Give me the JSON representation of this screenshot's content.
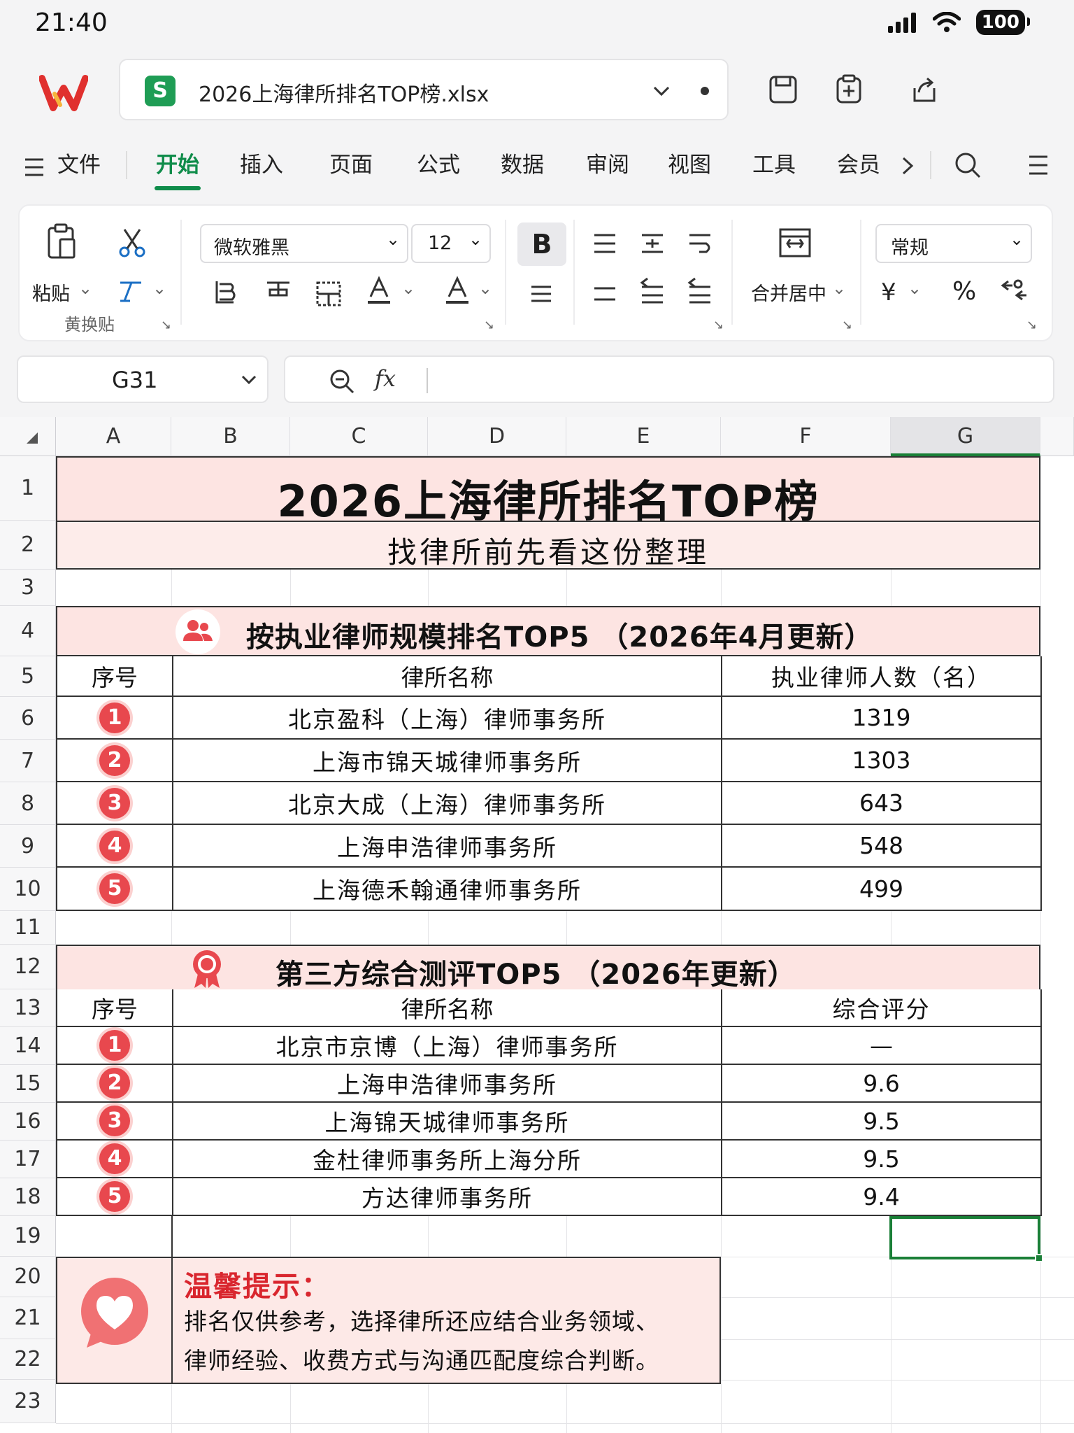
{
  "status": {
    "time": "21:40",
    "battery": "100"
  },
  "titlebar": {
    "file_icon_letter": "S",
    "file_name": "2026上海律所排名TOP榜.xlsx"
  },
  "tabs": [
    {
      "label": "文件"
    },
    {
      "label": "开始"
    },
    {
      "label": "插入"
    },
    {
      "label": "页面"
    },
    {
      "label": "公式"
    },
    {
      "label": "数据"
    },
    {
      "label": "审阅"
    },
    {
      "label": "视图"
    },
    {
      "label": "工具"
    },
    {
      "label": "会员"
    }
  ],
  "ribbon": {
    "paste_label": "粘贴",
    "paste_special_label": "黄换贴",
    "font_name": "微软雅黑",
    "font_size": "12",
    "bold_label": "B",
    "merge_label": "合并居中",
    "number_format": "常规",
    "currency_symbol": "¥",
    "percent_symbol": "%"
  },
  "formula_bar": {
    "cell_ref": "G31",
    "fx_label": "fx",
    "content": ""
  },
  "columns": [
    "A",
    "B",
    "C",
    "D",
    "E",
    "F",
    "G"
  ],
  "rows": [
    "1",
    "2",
    "3",
    "4",
    "5",
    "6",
    "7",
    "8",
    "9",
    "10",
    "11",
    "12",
    "13",
    "14",
    "15",
    "16",
    "17",
    "18",
    "19",
    "20",
    "21",
    "22",
    "23"
  ],
  "sheet": {
    "title": "2026上海律所排名TOP榜",
    "subtitle": "找律所前先看这份整理",
    "section1": {
      "heading": "按执业律师规模排名TOP5 （2026年4月更新）",
      "headers": [
        "序号",
        "律所名称",
        "执业律师人数（名）"
      ],
      "rows": [
        {
          "rank": "1",
          "name": "北京盈科（上海）律师事务所",
          "value": "1319"
        },
        {
          "rank": "2",
          "name": "上海市锦天城律师事务所",
          "value": "1303"
        },
        {
          "rank": "3",
          "name": "北京大成（上海）律师事务所",
          "value": "643"
        },
        {
          "rank": "4",
          "name": "上海申浩律师事务所",
          "value": "548"
        },
        {
          "rank": "5",
          "name": "上海德禾翰通律师事务所",
          "value": "499"
        }
      ]
    },
    "section2": {
      "heading": "第三方综合测评TOP5 （2026年更新）",
      "headers": [
        "序号",
        "律所名称",
        "综合评分"
      ],
      "rows": [
        {
          "rank": "1",
          "name": "北京市京博（上海）律师事务所",
          "value": "—"
        },
        {
          "rank": "2",
          "name": "上海申浩律师事务所",
          "value": "9.6"
        },
        {
          "rank": "3",
          "name": "上海锦天城律师事务所",
          "value": "9.5"
        },
        {
          "rank": "4",
          "name": "金杜律师事务所上海分所",
          "value": "9.5"
        },
        {
          "rank": "5",
          "name": "方达律师事务所",
          "value": "9.4"
        }
      ]
    },
    "tip": {
      "title": "温馨提示：",
      "line1": "排名仅供参考，选择律所还应结合业务领域、",
      "line2": "律师经验、收费方式与沟通匹配度综合判断。"
    }
  },
  "colors": {
    "accent_green": "#0f8c4a",
    "pink_band": "#fde4e2",
    "rank_red": "#e8484e"
  }
}
